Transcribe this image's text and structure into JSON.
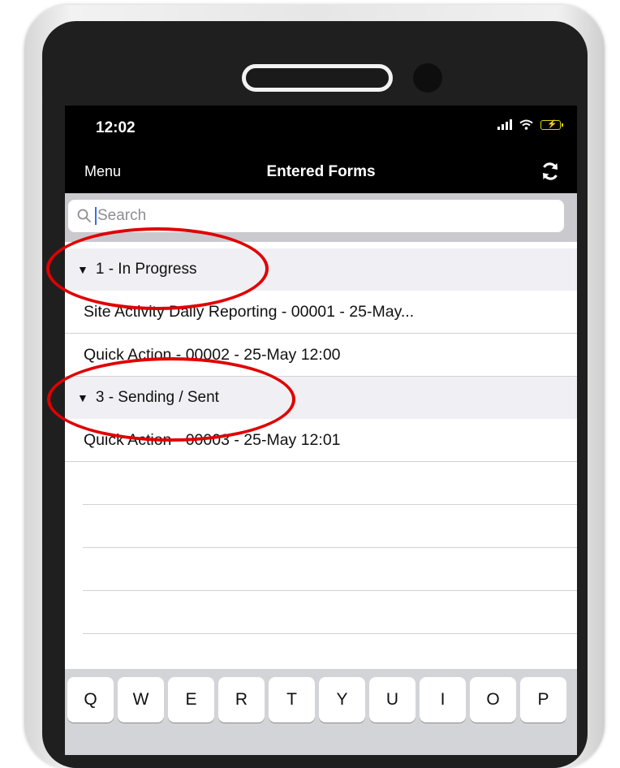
{
  "status_bar": {
    "time": "12:02"
  },
  "nav": {
    "menu_label": "Menu",
    "title": "Entered Forms"
  },
  "search": {
    "placeholder": "Search"
  },
  "sections": [
    {
      "title": "1 - In Progress",
      "items": [
        "Site Activity Daily Reporting - 00001 - 25-May...",
        "Quick Action - 00002 - 25-May 12:00"
      ]
    },
    {
      "title": "3 - Sending / Sent",
      "items": [
        "Quick Action - 00003 - 25-May 12:01"
      ]
    }
  ],
  "annotation_color": "#e00000",
  "keyboard": {
    "row1": [
      "Q",
      "W",
      "E",
      "R",
      "T",
      "Y",
      "U",
      "I",
      "O",
      "P"
    ]
  }
}
